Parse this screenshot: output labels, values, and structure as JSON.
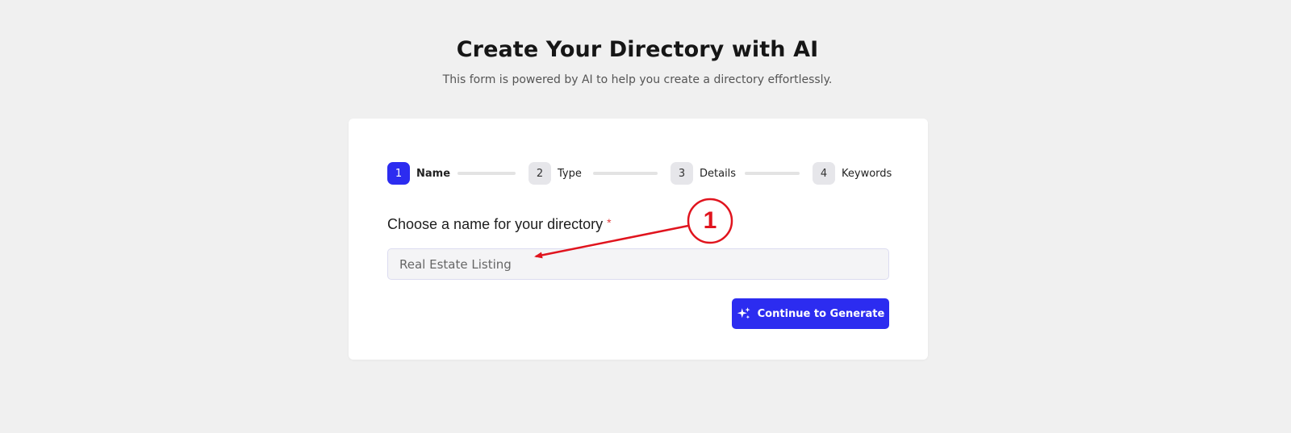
{
  "header": {
    "title": "Create Your Directory with AI",
    "subtitle": "This form is powered by AI to help you create a directory effortlessly."
  },
  "stepper": {
    "steps": [
      {
        "number": "1",
        "label": "Name",
        "active": true
      },
      {
        "number": "2",
        "label": "Type",
        "active": false
      },
      {
        "number": "3",
        "label": "Details",
        "active": false
      },
      {
        "number": "4",
        "label": "Keywords",
        "active": false
      }
    ]
  },
  "form": {
    "name_label": "Choose a name for your directory",
    "required_marker": "*",
    "name_placeholder": "Real Estate Listing",
    "name_value": ""
  },
  "actions": {
    "continue_label": "Continue to Generate",
    "continue_icon": "sparkles-icon"
  },
  "annotation": {
    "number": "1"
  },
  "colors": {
    "accent": "#2c2cf0",
    "background": "#f0f0f0",
    "card": "#ffffff",
    "annotation": "#e0141e",
    "required": "#e23b3b"
  }
}
